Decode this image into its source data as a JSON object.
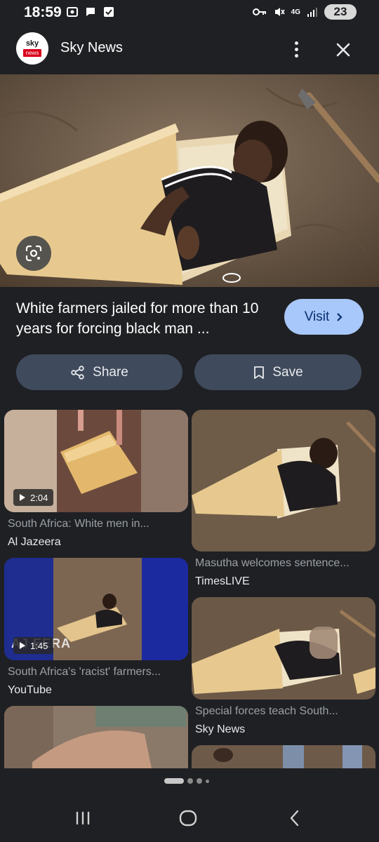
{
  "status_bar": {
    "time": "18:59",
    "network": "4G",
    "battery": "23"
  },
  "header": {
    "logo_top": "sky",
    "logo_bottom": "news",
    "title": "Sky News"
  },
  "main_result": {
    "headline": "White farmers jailed for more than 10 years for forcing black man ...",
    "visit_label": "Visit"
  },
  "actions": {
    "share_label": "Share",
    "save_label": "Save"
  },
  "related": [
    {
      "title": "South Africa: White men in...",
      "source": "Al Jazeera",
      "duration": "2:04"
    },
    {
      "title": "Masutha welcomes sentence...",
      "source": "TimesLIVE"
    },
    {
      "title": "South Africa's 'racist' farmers...",
      "source": "YouTube",
      "duration": "1:45",
      "watermark": "AJ EERA"
    },
    {
      "title": "Special forces teach South...",
      "source": "Sky News"
    }
  ],
  "icons": {
    "close": "close-icon",
    "more": "more-vert-icon",
    "lens": "lens-icon",
    "share": "share-icon",
    "save": "bookmark-icon",
    "play": "play-icon"
  },
  "colors": {
    "background": "#1f2023",
    "visit_button": "#a8c7fa",
    "action_button": "#3f4a5c",
    "sky_red": "#d9001b"
  }
}
